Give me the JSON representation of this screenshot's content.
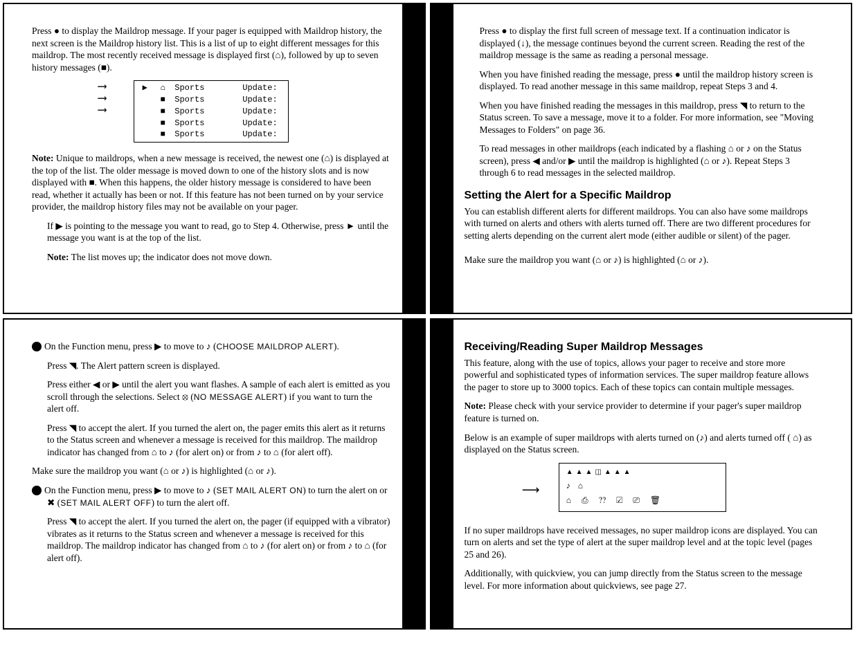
{
  "p1": {
    "para1": "Press ● to display the Maildrop message. If your pager is equipped with Maildrop history, the next screen is the Maildrop history list. This is a list of up to eight different messages for this maildrop. The most recently received message is displayed first (⌂), followed by up to seven history messages (■).",
    "rows": [
      {
        "a": "▶",
        "b": "⌂",
        "c": "Sports",
        "d": "Update:"
      },
      {
        "a": "",
        "b": "■",
        "c": "Sports",
        "d": "Update:"
      },
      {
        "a": "",
        "b": "■",
        "c": "Sports",
        "d": "Update:"
      },
      {
        "a": "",
        "b": "■",
        "c": "Sports",
        "d": "Update:"
      },
      {
        "a": "",
        "b": "■",
        "c": "Sports",
        "d": "Update:"
      }
    ],
    "note_label": "Note:",
    "note": " Unique to maildrops, when a new message is received, the newest one (⌂) is displayed at the top of the list. The older message is moved down to one of the history slots and is now displayed with ■. When this happens, the older history message is considered to have been read, whether it actually has been or not. If this feature has not been turned on by your service provider, the maildrop history files may not be available on your pager.",
    "para3": "If ▶ is pointing to the message you want to read, go to Step 4. Otherwise, press ► until the message you want is at the top of the list.",
    "note2_label": "Note:",
    "note2": " The list moves up; the indicator does not move down."
  },
  "p2": {
    "para1": "Press ● to display the first full screen of message text. If a continuation indicator is displayed (↓), the message continues beyond the current screen. Reading the rest of the maildrop message is the same as reading a personal message.",
    "para2": "When you have finished reading the message, press ● until the maildrop history screen is displayed. To read another message in this same maildrop, repeat Steps 3 and 4.",
    "para3": "When you have finished reading the messages in this maildrop, press ◥ to return to the Status screen. To save a message, move it to a folder. For more information, see \"Moving Messages to Folders\" on page 36.",
    "para4": "To read messages in other maildrops (each indicated by a flashing ⌂ or ♪ on the Status screen), press ◀ and/or ▶ until the maildrop is highlighted (⌂ or ♪). Repeat Steps 3 through 6 to read messages in the selected maildrop.",
    "h1": "Setting the Alert for a Specific Maildrop",
    "para5": "You can establish different alerts for different maildrops. You can also have some maildrops with turned on alerts and others with alerts turned off. There are two different procedures for setting alerts depending on the current alert mode (either audible or silent) of the pager.",
    "para6": "Make sure the maildrop you want (⌂ or ♪) is highlighted (⌂ or ♪)."
  },
  "p3": {
    "step1a": "On the Function menu, press ▶ to move to ♪ (",
    "step1b": "CHOOSE MAILDROP ALERT",
    "step1c": ").",
    "para2": "Press ◥. The Alert pattern screen is displayed.",
    "para3a": "Press either ◀ or ▶ until the alert you want flashes. A sample of each alert is emitted as you scroll through the selections. Select ⦻ (",
    "para3b": "NO MESSAGE ALERT",
    "para3c": ") if you want to turn the alert off.",
    "para4": "Press ◥ to accept the alert. If you turned the alert on, the pager emits this alert as it returns to the Status screen and whenever a message is received for this maildrop. The maildrop indicator has changed from ⌂ to ♪ (for alert on) or from ♪ to ⌂ (for alert off).",
    "para5": "Make sure the maildrop you want (⌂ or ♪) is highlighted (⌂ or ♪).",
    "step2a": "On the Function menu, press ▶ to move to ♪ (",
    "step2b": "SET MAIL ALERT ON",
    "step2c": ") to turn the alert on or ✖ (",
    "step2d": "SET MAIL ALERT OFF",
    "step2e": ") to turn the alert off.",
    "para7": "Press ◥ to accept the alert. If you turned the alert on, the pager (if equipped with a vibrator) vibrates as it returns to the Status screen and whenever a message is received for this maildrop. The maildrop indicator has changed from ⌂ to ♪ (for alert on) or from ♪ to ⌂ (for alert off)."
  },
  "p4": {
    "h1": "Receiving/Reading Super Maildrop Messages",
    "para1": "This feature, along with the use of topics, allows your pager to receive and store more powerful and sophisticated types of information services. The super maildrop feature allows the pager to store up to 3000 topics. Each of these topics can contain multiple messages.",
    "note_label": "Note:",
    "note": " Please check with your service provider to determine if your pager's super maildrop feature is turned on.",
    "para3": "Below is an example of super maildrops with alerts turned on (♪) and alerts turned off ( ⌂) as displayed on the Status screen.",
    "status_row1": "▲▲▲◫▲▲▲",
    "status_row2": "♪ ⌂",
    "status_row3": "⌂  ⎙  ⁇  ☑     ⎚  🗑",
    "para4": "If no super maildrops have received messages, no super maildrop icons are displayed. You can turn on alerts and set the type of alert at the super maildrop level and at the topic level (pages 25 and 26).",
    "para5": "Additionally, with quickview, you can jump directly from the Status screen to the message level. For more information about quickviews, see page 27."
  }
}
